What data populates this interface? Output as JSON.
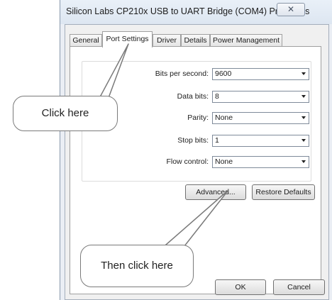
{
  "window": {
    "title": "Silicon Labs CP210x USB to UART Bridge (COM4) Properties",
    "close_label": "✕"
  },
  "tabs": [
    {
      "label": "General"
    },
    {
      "label": "Port Settings"
    },
    {
      "label": "Driver"
    },
    {
      "label": "Details"
    },
    {
      "label": "Power Management"
    }
  ],
  "settings": {
    "bits_per_second": {
      "label": "Bits per second:",
      "value": "9600"
    },
    "data_bits": {
      "label": "Data bits:",
      "value": "8"
    },
    "parity": {
      "label": "Parity:",
      "value": "None"
    },
    "stop_bits": {
      "label": "Stop bits:",
      "value": "1"
    },
    "flow_control": {
      "label": "Flow control:",
      "value": "None"
    }
  },
  "buttons": {
    "advanced": "Advanced...",
    "restore_defaults": "Restore Defaults",
    "ok": "OK",
    "cancel": "Cancel"
  },
  "callouts": {
    "first": "Click here",
    "second": "Then click here"
  }
}
